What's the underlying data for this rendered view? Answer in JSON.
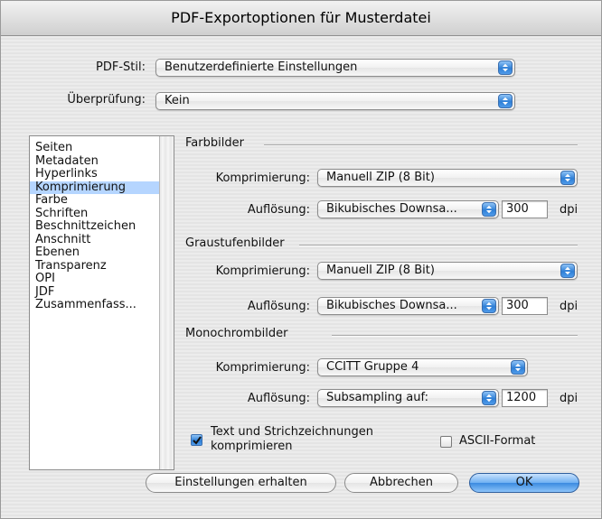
{
  "window": {
    "title": "PDF-Exportoptionen für Musterdatei"
  },
  "header": {
    "style_label": "PDF-Stil:",
    "style_value": "Benutzerdefinierte Einstellungen",
    "check_label": "Überprüfung:",
    "check_value": "Kein"
  },
  "sidebar": {
    "items": [
      {
        "label": "Seiten",
        "selected": false
      },
      {
        "label": "Metadaten",
        "selected": false
      },
      {
        "label": "Hyperlinks",
        "selected": false
      },
      {
        "label": "Komprimierung",
        "selected": true
      },
      {
        "label": "Farbe",
        "selected": false
      },
      {
        "label": "Schriften",
        "selected": false
      },
      {
        "label": "Beschnittzeichen",
        "selected": false
      },
      {
        "label": "Anschnitt",
        "selected": false
      },
      {
        "label": "Ebenen",
        "selected": false
      },
      {
        "label": "Transparenz",
        "selected": false
      },
      {
        "label": "OPI",
        "selected": false
      },
      {
        "label": "JDF",
        "selected": false
      },
      {
        "label": "Zusammenfass...",
        "selected": false
      }
    ]
  },
  "color": {
    "title": "Farbbilder",
    "compression_label": "Komprimierung:",
    "compression_value": "Manuell ZIP (8 Bit)",
    "resolution_label": "Auflösung:",
    "resolution_method": "Bikubisches Downsa...",
    "resolution_value": "300",
    "unit": "dpi"
  },
  "gray": {
    "title": "Graustufenbilder",
    "compression_label": "Komprimierung:",
    "compression_value": "Manuell ZIP (8 Bit)",
    "resolution_label": "Auflösung:",
    "resolution_method": "Bikubisches Downsa...",
    "resolution_value": "300",
    "unit": "dpi"
  },
  "mono": {
    "title": "Monochrombilder",
    "compression_label": "Komprimierung:",
    "compression_value": "CCITT Gruppe 4",
    "resolution_label": "Auflösung:",
    "resolution_method": "Subsampling auf:",
    "resolution_value": "1200",
    "unit": "dpi"
  },
  "options": {
    "compress_text_line1": "Text und Strichzeichnungen",
    "compress_text_line2": "komprimieren",
    "compress_text_checked": true,
    "ascii_label": "ASCII-Format",
    "ascii_checked": false
  },
  "buttons": {
    "keep_label": "Einstellungen erhalten",
    "cancel_label": "Abbrechen",
    "ok_label": "OK"
  },
  "colors": {
    "accent": "#2f7fd6",
    "selection": "#b5d5ff"
  }
}
